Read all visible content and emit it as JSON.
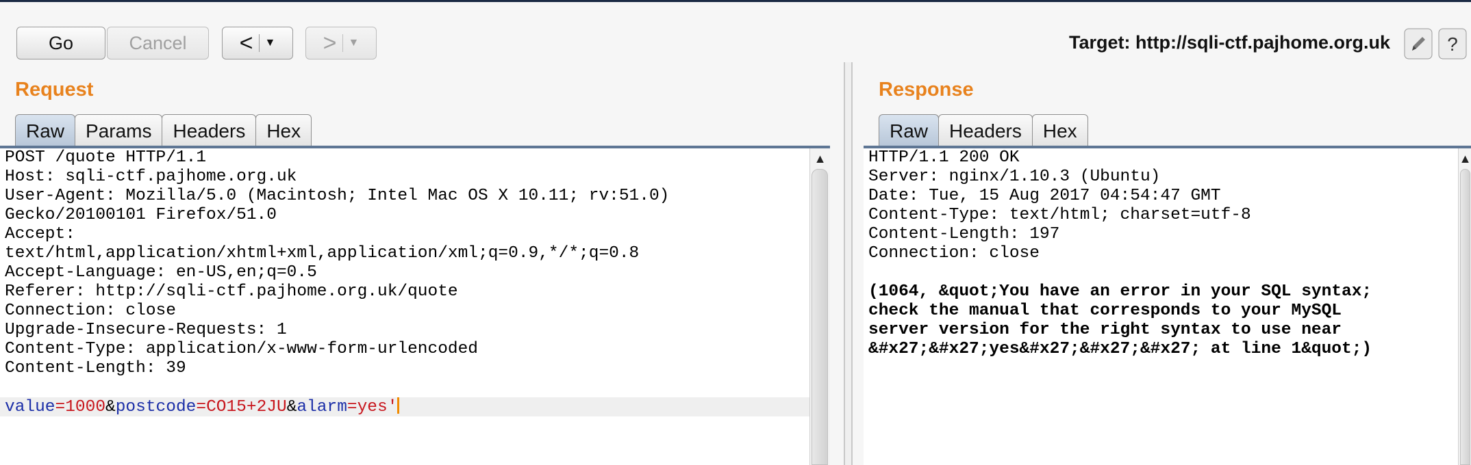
{
  "toolbar": {
    "go_label": "Go",
    "cancel_label": "Cancel",
    "back_label": "<",
    "forward_label": ">",
    "dropdown_glyph": "▼",
    "target_label": "Target: http://sqli-ctf.pajhome.org.uk",
    "edit_icon": "pencil-icon",
    "help_label": "?"
  },
  "request": {
    "title": "Request",
    "tabs": [
      {
        "label": "Raw",
        "active": true
      },
      {
        "label": "Params",
        "active": false
      },
      {
        "label": "Headers",
        "active": false
      },
      {
        "label": "Hex",
        "active": false
      }
    ],
    "lines": [
      "POST /quote HTTP/1.1",
      "Host: sqli-ctf.pajhome.org.uk",
      "User-Agent: Mozilla/5.0 (Macintosh; Intel Mac OS X 10.11; rv:51.0)",
      "Gecko/20100101 Firefox/51.0",
      "Accept:",
      "text/html,application/xhtml+xml,application/xml;q=0.9,*/*;q=0.8",
      "Accept-Language: en-US,en;q=0.5",
      "Referer: http://sqli-ctf.pajhome.org.uk/quote",
      "Connection: close",
      "Upgrade-Insecure-Requests: 1",
      "Content-Type: application/x-www-form-urlencoded",
      "Content-Length: 39",
      ""
    ],
    "body_params": {
      "k1": "value",
      "eq1": "=",
      "v1": "1000",
      "amp1": "&",
      "k2": "postcode",
      "eq2": "=",
      "v2": "CO15+2JU",
      "amp2": "&",
      "k3": "alarm",
      "eq3": "=",
      "v3": "yes'"
    }
  },
  "response": {
    "title": "Response",
    "tabs": [
      {
        "label": "Raw",
        "active": true
      },
      {
        "label": "Headers",
        "active": false
      },
      {
        "label": "Hex",
        "active": false
      }
    ],
    "lines": [
      "HTTP/1.1 200 OK",
      "Server: nginx/1.10.3 (Ubuntu)",
      "Date: Tue, 15 Aug 2017 04:54:47 GMT",
      "Content-Type: text/html; charset=utf-8",
      "Content-Length: 197",
      "Connection: close",
      ""
    ],
    "body_lines": [
      "(1064, &quot;You have an error in your SQL syntax;",
      "check the manual that corresponds to your MySQL",
      "server version for the right syntax to use near",
      "&#x27;&#x27;yes&#x27;&#x27;&#x27; at line 1&quot;)"
    ]
  },
  "colors": {
    "section_title": "#e8821d",
    "param_key": "#1c2fa8",
    "param_value": "#c8161d",
    "caret": "#f08a00"
  }
}
